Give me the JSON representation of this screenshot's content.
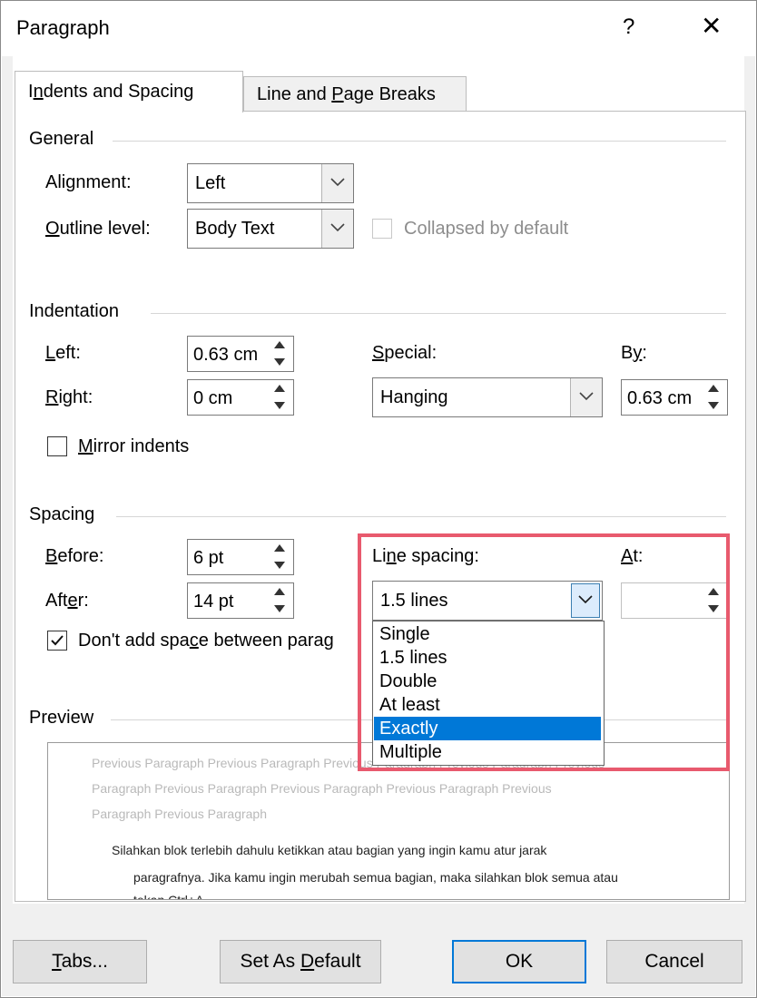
{
  "window": {
    "title": "Paragraph",
    "help_glyph": "?",
    "close_glyph": "✕"
  },
  "tabs": [
    {
      "label_pre": "I",
      "label_u": "n",
      "label_post": "dents and Spacing",
      "active": true
    },
    {
      "label_pre": "Line and ",
      "label_u": "P",
      "label_post": "age Breaks",
      "active": false
    }
  ],
  "general": {
    "section_label": "General",
    "alignment_label_pre": "Ali",
    "alignment_label_u": "g",
    "alignment_label_post": "nment:",
    "alignment_value": "Left",
    "outline_label_pre": "",
    "outline_label_u": "O",
    "outline_label_post": "utline level:",
    "outline_value": "Body Text",
    "collapsed_label": "Collapsed by default",
    "collapsed_checked": false
  },
  "indentation": {
    "section_label": "Indentation",
    "left_label_pre": "",
    "left_label_u": "L",
    "left_label_post": "eft:",
    "left_value": "0.63 cm",
    "right_label_pre": "",
    "right_label_u": "R",
    "right_label_post": "ight:",
    "right_value": "0 cm",
    "special_label_pre": "",
    "special_label_u": "S",
    "special_label_post": "pecial:",
    "special_value": "Hanging",
    "by_label_pre": "B",
    "by_label_u": "y",
    "by_label_post": ":",
    "by_value": "0.63 cm",
    "mirror_label_pre": "",
    "mirror_label_u": "M",
    "mirror_label_post": "irror indents",
    "mirror_checked": false
  },
  "spacing": {
    "section_label": "Spacing",
    "before_label_pre": "",
    "before_label_u": "B",
    "before_label_post": "efore:",
    "before_value": "6 pt",
    "after_label_pre": "Aft",
    "after_label_u": "e",
    "after_label_post": "r:",
    "after_value": "14 pt",
    "line_spacing_label_pre": "Li",
    "line_spacing_label_u": "n",
    "line_spacing_label_post": "e spacing:",
    "line_spacing_value": "1.5 lines",
    "at_label_pre": "",
    "at_label_u": "A",
    "at_label_post": "t:",
    "at_value": "",
    "dont_add_label_pre": "Don't add spa",
    "dont_add_label_u": "c",
    "dont_add_label_post": "e between parag",
    "dont_add_checked": true,
    "line_spacing_options": [
      "Single",
      "1.5 lines",
      "Double",
      "At least",
      "Exactly",
      "Multiple"
    ],
    "highlighted_option": "Exactly"
  },
  "preview": {
    "section_label": "Preview",
    "prev_lines": [
      "Previous Paragraph Previous Paragraph Previous Paragraph Previous Paragraph Previous",
      "Paragraph Previous Paragraph Previous Paragraph Previous Paragraph Previous",
      "Paragraph Previous Paragraph"
    ],
    "sample_lines": [
      "Silahkan blok terlebih dahulu ketikkan atau bagian yang ingin kamu atur jarak",
      "paragrafnya. Jika kamu ingin merubah semua bagian, maka silahkan blok semua atau",
      "tekan Ctrl+A."
    ]
  },
  "buttons": {
    "tabs_pre": "",
    "tabs_u": "T",
    "tabs_post": "abs...",
    "default_pre": "Set As ",
    "default_u": "D",
    "default_post": "efault",
    "ok": "OK",
    "cancel": "Cancel"
  },
  "colors": {
    "accent": "#0078d7",
    "highlight_box": "#e85a6e"
  }
}
